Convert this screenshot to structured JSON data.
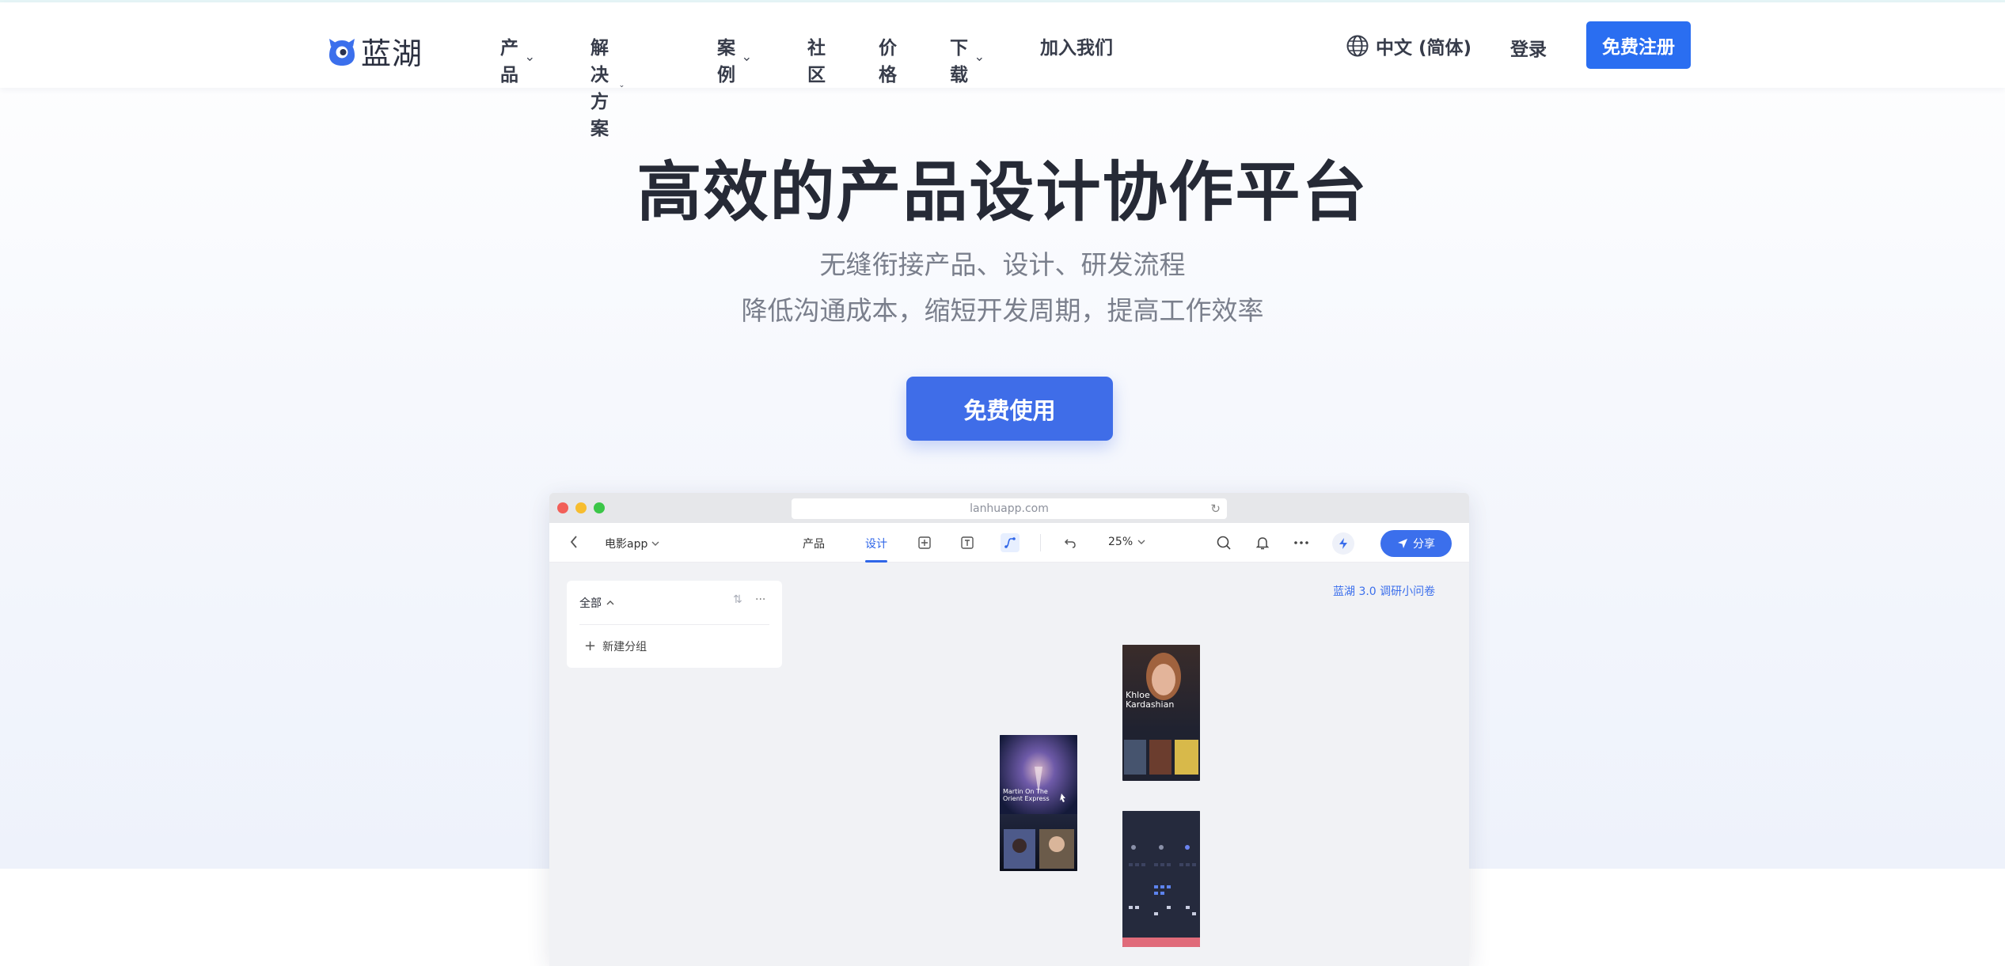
{
  "brand": {
    "name": "蓝湖"
  },
  "nav": {
    "items": [
      {
        "label": "产品",
        "dropdown": true
      },
      {
        "label": "解决方案",
        "dropdown": true
      },
      {
        "label": "案例",
        "dropdown": true
      },
      {
        "label": "社区",
        "dropdown": false
      },
      {
        "label": "价格",
        "dropdown": false
      },
      {
        "label": "下载",
        "dropdown": true
      },
      {
        "label": "加入我们",
        "dropdown": false
      }
    ],
    "language": "中文 (简体)",
    "login": "登录",
    "signup": "免费注册"
  },
  "hero": {
    "title": "高效的产品设计协作平台",
    "subtitle_line1": "无缝衔接产品、设计、研发流程",
    "subtitle_line2": "降低沟通成本，缩短开发周期，提高工作效率",
    "cta": "免费使用"
  },
  "mock": {
    "url": "lanhuapp.com",
    "project": "电影app",
    "tabs": [
      "产品",
      "设计"
    ],
    "active_tab": "设计",
    "zoom": "25%",
    "share": "分享",
    "panel": {
      "title": "全部",
      "new_group": "新建分组"
    },
    "survey": "蓝湖 3.0 调研小问卷",
    "frames": {
      "movie_title": "Martin On The Orient Express",
      "person_name": "Khloe Kardashian"
    }
  },
  "colors": {
    "primary": "#2a6ef1",
    "cta": "#3f6de8",
    "title": "#262a36",
    "subtitle": "#7a7f8c"
  }
}
